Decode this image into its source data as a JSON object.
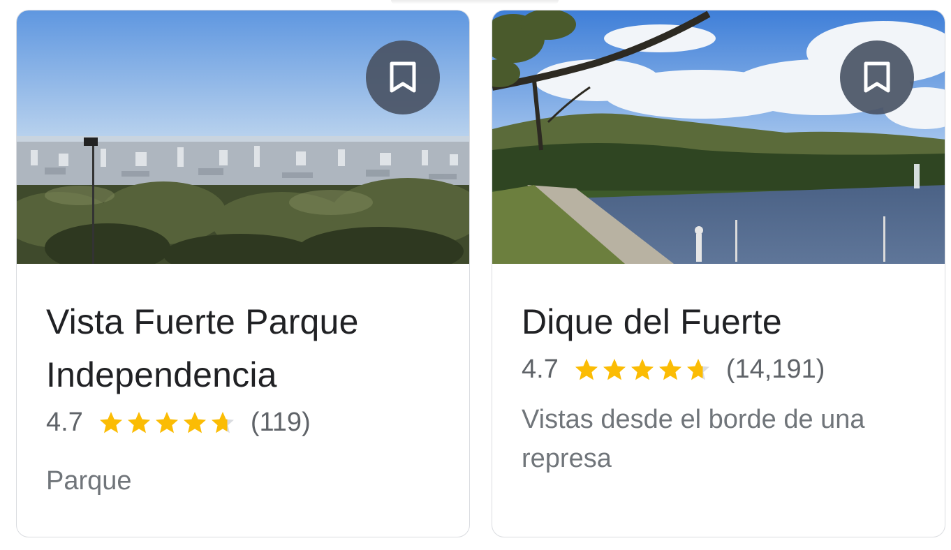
{
  "cards": [
    {
      "title": "Vista Fuerte Parque Independencia",
      "rating": "4.7",
      "stars": 4.7,
      "reviews": "(119)",
      "subtitle": "Parque",
      "bookmark_icon": "bookmark-icon",
      "photo": "city-overlook-photo"
    },
    {
      "title": "Dique del Fuerte",
      "rating": "4.7",
      "stars": 4.7,
      "reviews": "(14,191)",
      "subtitle": "Vistas desde el borde de una represa",
      "bookmark_icon": "bookmark-icon",
      "photo": "dam-lake-photo"
    }
  ],
  "colors": {
    "star": "#fbbc04",
    "star_empty": "#dadce0",
    "title": "#202124",
    "secondary": "#70757a",
    "bookmark_bg": "#4a5465"
  }
}
